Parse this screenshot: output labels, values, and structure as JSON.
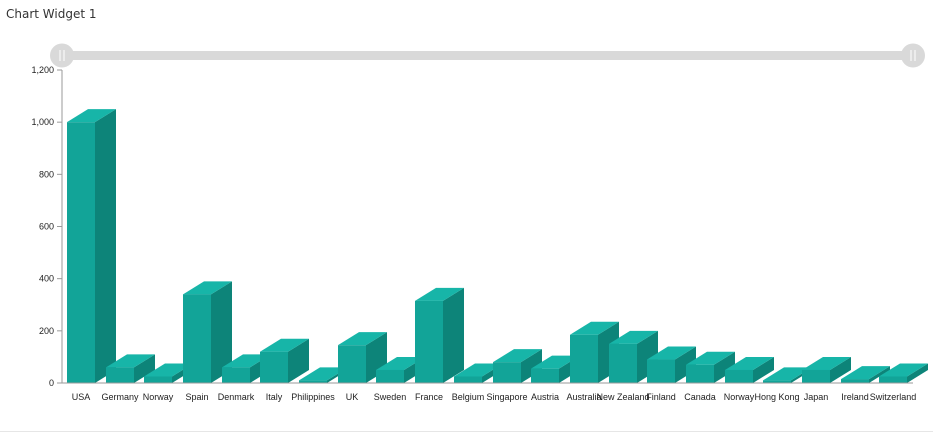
{
  "widget": {
    "title": "Chart Widget 1"
  },
  "colors": {
    "bar_front": "#12a498",
    "bar_side": "#0d8479",
    "bar_top": "#17b5a8",
    "range_track": "#d9d9d9",
    "range_handle": "#d9d9d9",
    "axis": "#9a9a9a"
  },
  "range_selector": {
    "start": 0,
    "end": 1
  },
  "chart_data": {
    "type": "bar",
    "style": "3d-column",
    "title": "",
    "xlabel": "",
    "ylabel": "",
    "ylim": [
      0,
      1200
    ],
    "yticks": [
      0,
      200,
      400,
      600,
      800,
      1000,
      1200
    ],
    "ytick_labels": [
      "0",
      "200",
      "400",
      "600",
      "800",
      "1,000",
      "1,200"
    ],
    "grid": false,
    "categories": [
      "USA",
      "Germany",
      "Norway",
      "Spain",
      "Denmark",
      "Italy",
      "Philippines",
      "UK",
      "Sweden",
      "France",
      "Belgium",
      "Singapore",
      "Austria",
      "Australia",
      "New Zealand",
      "Finland",
      "Canada",
      "Norway",
      "Hong Kong",
      "Japan",
      "Ireland",
      "Switzerland"
    ],
    "values": [
      1000,
      60,
      25,
      340,
      60,
      120,
      10,
      145,
      50,
      315,
      25,
      80,
      55,
      185,
      150,
      90,
      70,
      50,
      10,
      50,
      15,
      25
    ]
  }
}
